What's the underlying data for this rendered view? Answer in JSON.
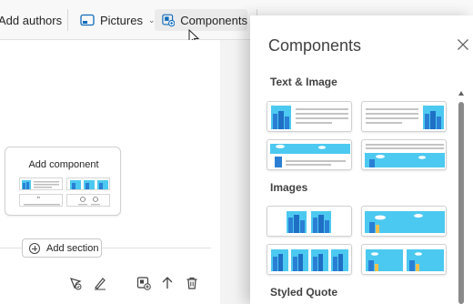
{
  "toolbar": {
    "add_authors_label": "Add authors",
    "pictures_label": "Pictures",
    "components_label": "Components"
  },
  "canvas": {
    "add_component_title": "Add component",
    "add_section_label": "Add section"
  },
  "panel": {
    "title": "Components",
    "sections": {
      "text_image": "Text & Image",
      "images": "Images",
      "styled_quote": "Styled Quote"
    }
  },
  "colors": {
    "accent": "#0f6cbd",
    "image_sky": "#4cc9f0",
    "image_building": "#2a7fd4"
  }
}
